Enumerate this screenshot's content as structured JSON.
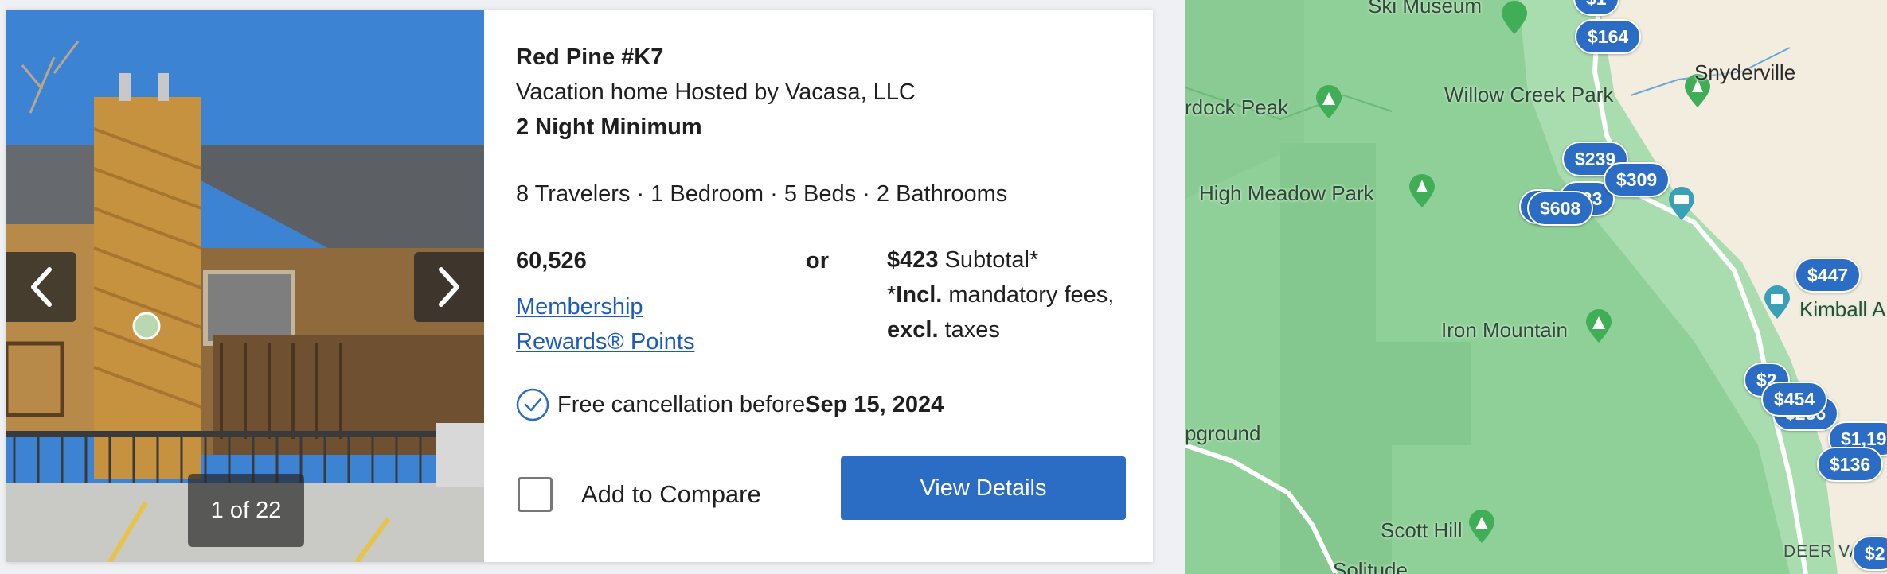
{
  "listing": {
    "title": "Red Pine #K7",
    "subtitle": "Vacation home Hosted by Vacasa, LLC",
    "minimum": "2 Night Minimum",
    "specs": "8 Travelers · 1 Bedroom · 5 Beds · 2 Bathrooms",
    "points": "60,526",
    "rewards_link": "Membership Rewards® Points",
    "or": "or",
    "price": "$423",
    "subtotal_label": " Subtotal*",
    "fees_prefix": "*",
    "fees_incl": "Incl.",
    "fees_mid": " mandatory fees, ",
    "fees_excl": "excl.",
    "fees_suffix": " taxes",
    "cancel_prefix": "Free cancellation before ",
    "cancel_date": "Sep 15, 2024",
    "compare_label": "Add to Compare",
    "view_button": "View Details"
  },
  "gallery": {
    "counter": "1 of 22",
    "prev_icon": "chevron-left-icon",
    "next_icon": "chevron-right-icon"
  },
  "map": {
    "labels": {
      "ski_museum": "Ski Museum",
      "snyderville": "Snyderville",
      "willow_creek": "Willow Creek Park",
      "murdock_peak": "rdock Peak",
      "high_meadow": "High Meadow Park",
      "iron_mountain": "Iron Mountain",
      "campground": "pground",
      "scott_hill": "Scott Hill",
      "solitude": "Solitude",
      "kimball": "Kimball A",
      "deer_valley": "DEER VA"
    },
    "price_pins": [
      "$164",
      "$239",
      "$309",
      "$608",
      "$447",
      "$454",
      "$1,19",
      "$136",
      "$2",
      "$1",
      "$23",
      "$1",
      "$2",
      "$236",
      "$1"
    ],
    "colors": {
      "forest": "#8fcf98",
      "pin_blue": "#2b6cc4",
      "park_green": "#3fae57"
    }
  }
}
